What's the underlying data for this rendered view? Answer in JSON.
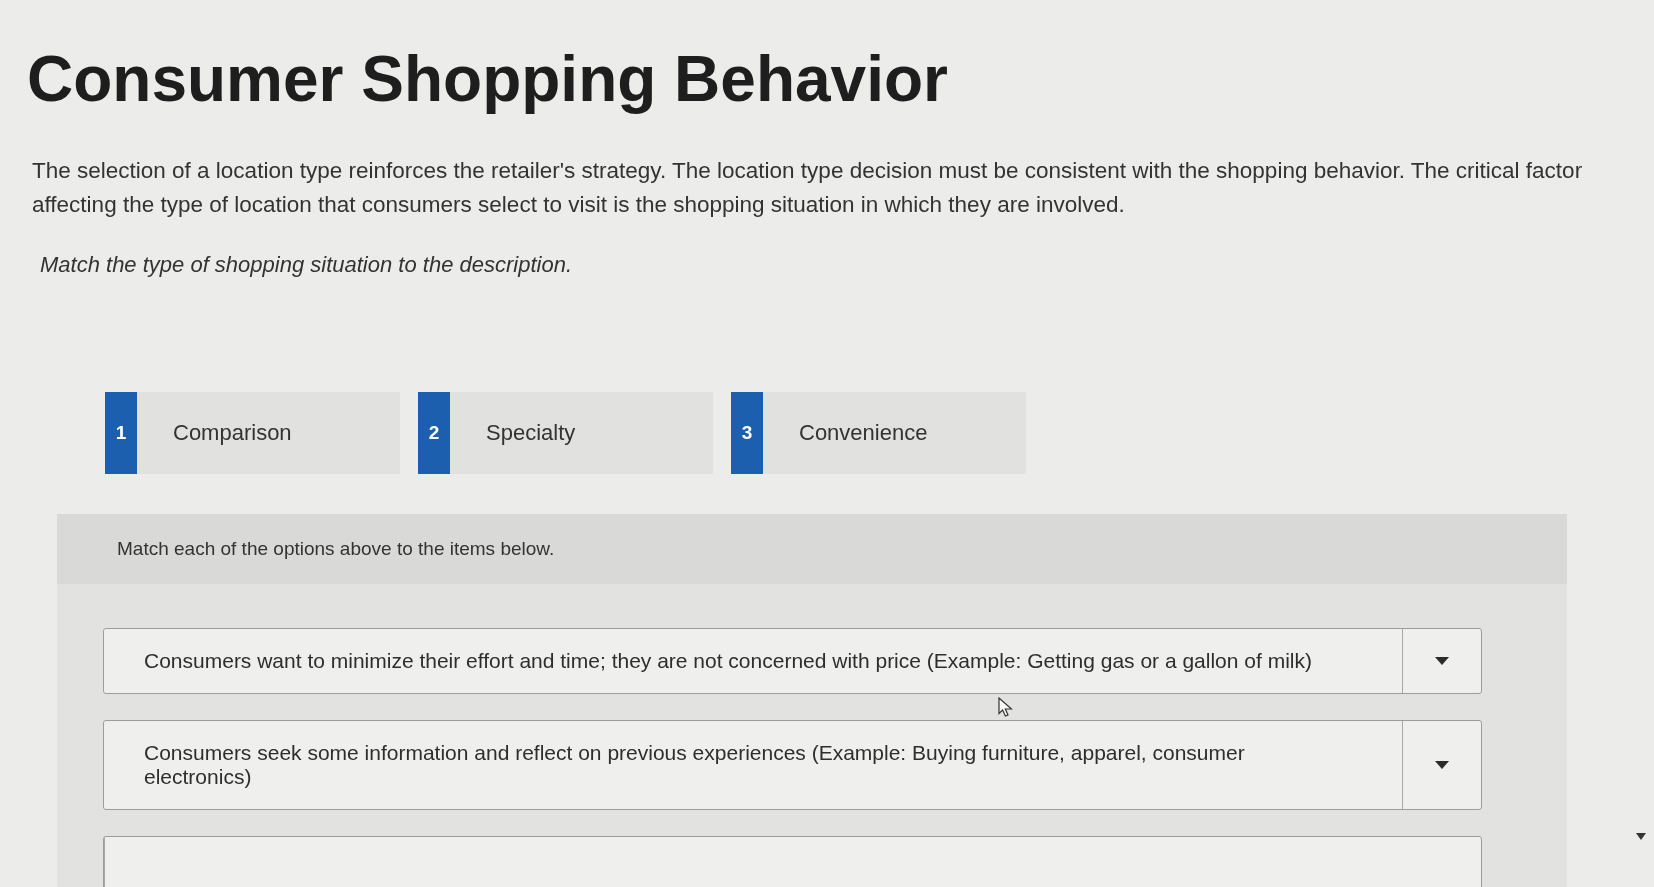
{
  "title": "Consumer Shopping Behavior",
  "intro": "The selection of a location type reinforces the retailer's strategy. The location type decision must be consistent with the shopping behavior. The critical factor affecting the type of location that consumers select to visit is the shopping situation in which they are involved.",
  "instruction": "Match the type of shopping situation to the description.",
  "options": [
    {
      "number": "1",
      "label": "Comparison"
    },
    {
      "number": "2",
      "label": "Specialty"
    },
    {
      "number": "3",
      "label": "Convenience"
    }
  ],
  "match_panel": {
    "header": "Match each of the options above to the items below.",
    "items": [
      {
        "kind": "dropdown",
        "text": "Consumers want to minimize their effort and time; they are not concerned with price (Example: Getting gas or a gallon of milk)"
      },
      {
        "kind": "dropdown",
        "text": "Consumers seek some information and reflect on previous experiences (Example: Buying furniture, apparel, consumer electronics)"
      },
      {
        "kind": "cut_off"
      }
    ]
  }
}
